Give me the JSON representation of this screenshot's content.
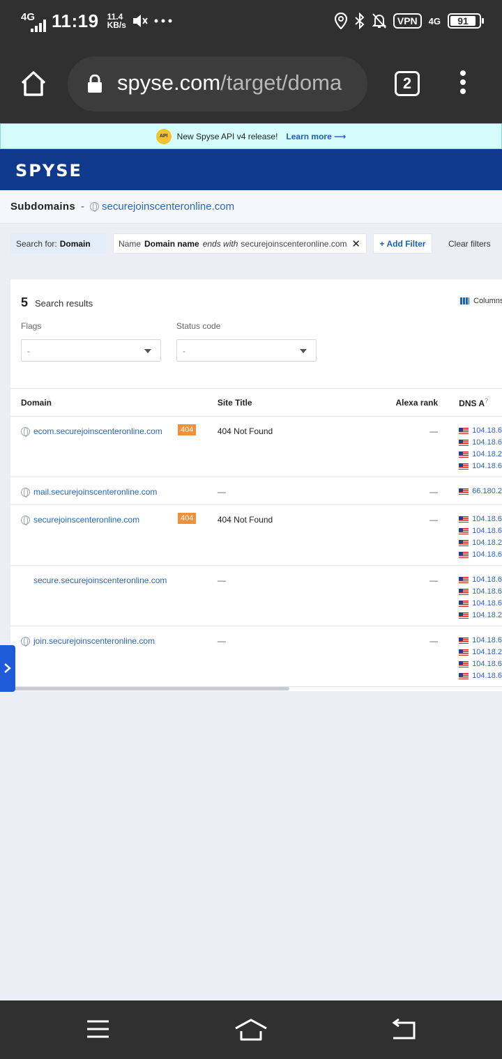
{
  "status_bar": {
    "signal_tag": "4G",
    "time": "11:19",
    "speed_value": "11.4",
    "speed_unit": "KB/s",
    "vpn": "VPN",
    "lte": "4G",
    "battery": "91"
  },
  "browser": {
    "url_host": "spyse.com",
    "url_path": "/target/doma",
    "tab_count": "2"
  },
  "banner": {
    "icon_text": "API",
    "text": "New Spyse API v4 release!",
    "link": "Learn more ⟶"
  },
  "header": {
    "logo": "SPYSE"
  },
  "breadcrumb": {
    "title": "Subdomains",
    "separator": "-",
    "domain": "securejoinscenteronline.com"
  },
  "filters": {
    "search_for_label": "Search for:",
    "search_for_value": "Domain",
    "name_label": "Name",
    "field": "Domain name",
    "operator": "ends with",
    "value": "securejoinscenteronline.com",
    "remove": "✕",
    "add_filter": "+ Add Filter",
    "clear_filters": "Clear filters"
  },
  "results": {
    "count": "5",
    "label": "Search results",
    "columns_button": "Columns",
    "flags_label": "Flags",
    "flags_value": "-",
    "status_label": "Status code",
    "status_value": "-"
  },
  "table": {
    "headers": {
      "domain": "Domain",
      "site_title": "Site Title",
      "alexa": "Alexa rank",
      "dns": "DNS A"
    },
    "rows": [
      {
        "domain": "ecom.securejoinscenteronline.com",
        "badge": "404",
        "title": "404 Not Found",
        "alexa": "—",
        "ips": [
          "104.18.6",
          "104.18.6",
          "104.18.2",
          "104.18.6"
        ]
      },
      {
        "domain": "mail.securejoinscenteronline.com",
        "badge": "",
        "title": "—",
        "alexa": "—",
        "ips": [
          "66.180.2"
        ]
      },
      {
        "domain": "securejoinscenteronline.com",
        "badge": "404",
        "title": "404 Not Found",
        "alexa": "—",
        "ips": [
          "104.18.6",
          "104.18.6",
          "104.18.2",
          "104.18.6"
        ]
      },
      {
        "domain": "secure.securejoinscenteronline.com",
        "badge": "",
        "title": "—",
        "alexa": "—",
        "ips": [
          "104.18.6",
          "104.18.6",
          "104.18.6",
          "104.18.2"
        ]
      },
      {
        "domain": "join.securejoinscenteronline.com",
        "badge": "",
        "title": "—",
        "alexa": "—",
        "ips": [
          "104.18.6",
          "104.18.2",
          "104.18.6",
          "104.18.6"
        ]
      }
    ]
  }
}
